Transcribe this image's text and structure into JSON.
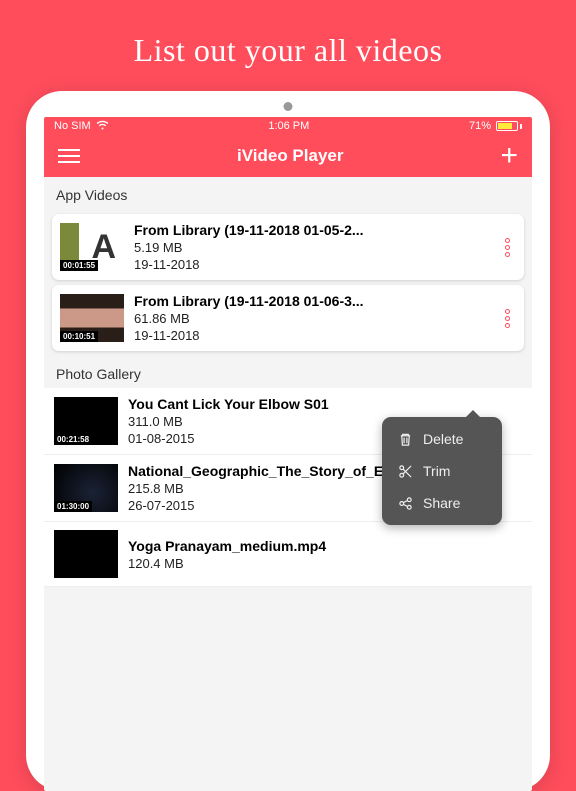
{
  "promo_headline": "List out your all videos",
  "status": {
    "carrier": "No SIM",
    "time": "1:06 PM",
    "battery": "71%"
  },
  "nav": {
    "title": "iVideo Player"
  },
  "sections": {
    "app_videos": {
      "header": "App Videos",
      "items": [
        {
          "title": "From Library (19-11-2018 01-05-2...",
          "size": "5.19 MB",
          "date": "19-11-2018",
          "duration": "00:01:55"
        },
        {
          "title": "From Library (19-11-2018 01-06-3...",
          "size": "61.86 MB",
          "date": "19-11-2018",
          "duration": "00:10:51"
        }
      ]
    },
    "photo_gallery": {
      "header": "Photo Gallery",
      "items": [
        {
          "title": "You Cant Lick Your Elbow S01",
          "size": "311.0 MB",
          "date": "01-08-2015",
          "duration": "00:21:58"
        },
        {
          "title": "National_Geographic_The_Story_of_Earth...",
          "size": "215.8 MB",
          "date": "26-07-2015",
          "duration": "01:30:00"
        },
        {
          "title": "Yoga Pranayam_medium.mp4",
          "size": "120.4 MB",
          "date": "",
          "duration": ""
        }
      ]
    }
  },
  "popover": {
    "delete": "Delete",
    "trim": "Trim",
    "share": "Share"
  }
}
